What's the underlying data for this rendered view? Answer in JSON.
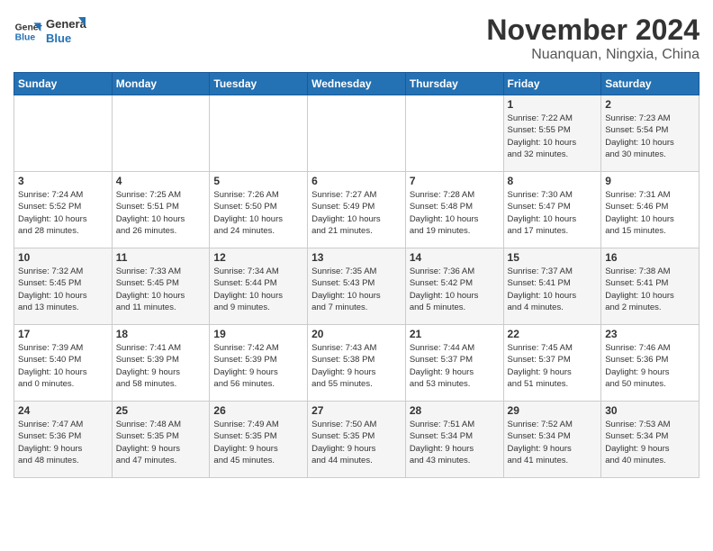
{
  "header": {
    "logo_line1": "General",
    "logo_line2": "Blue",
    "month": "November 2024",
    "location": "Nuanquan, Ningxia, China"
  },
  "days_of_week": [
    "Sunday",
    "Monday",
    "Tuesday",
    "Wednesday",
    "Thursday",
    "Friday",
    "Saturday"
  ],
  "weeks": [
    [
      {
        "day": null,
        "info": null
      },
      {
        "day": null,
        "info": null
      },
      {
        "day": null,
        "info": null
      },
      {
        "day": null,
        "info": null
      },
      {
        "day": null,
        "info": null
      },
      {
        "day": "1",
        "info": "Sunrise: 7:22 AM\nSunset: 5:55 PM\nDaylight: 10 hours\nand 32 minutes."
      },
      {
        "day": "2",
        "info": "Sunrise: 7:23 AM\nSunset: 5:54 PM\nDaylight: 10 hours\nand 30 minutes."
      }
    ],
    [
      {
        "day": "3",
        "info": "Sunrise: 7:24 AM\nSunset: 5:52 PM\nDaylight: 10 hours\nand 28 minutes."
      },
      {
        "day": "4",
        "info": "Sunrise: 7:25 AM\nSunset: 5:51 PM\nDaylight: 10 hours\nand 26 minutes."
      },
      {
        "day": "5",
        "info": "Sunrise: 7:26 AM\nSunset: 5:50 PM\nDaylight: 10 hours\nand 24 minutes."
      },
      {
        "day": "6",
        "info": "Sunrise: 7:27 AM\nSunset: 5:49 PM\nDaylight: 10 hours\nand 21 minutes."
      },
      {
        "day": "7",
        "info": "Sunrise: 7:28 AM\nSunset: 5:48 PM\nDaylight: 10 hours\nand 19 minutes."
      },
      {
        "day": "8",
        "info": "Sunrise: 7:30 AM\nSunset: 5:47 PM\nDaylight: 10 hours\nand 17 minutes."
      },
      {
        "day": "9",
        "info": "Sunrise: 7:31 AM\nSunset: 5:46 PM\nDaylight: 10 hours\nand 15 minutes."
      }
    ],
    [
      {
        "day": "10",
        "info": "Sunrise: 7:32 AM\nSunset: 5:45 PM\nDaylight: 10 hours\nand 13 minutes."
      },
      {
        "day": "11",
        "info": "Sunrise: 7:33 AM\nSunset: 5:45 PM\nDaylight: 10 hours\nand 11 minutes."
      },
      {
        "day": "12",
        "info": "Sunrise: 7:34 AM\nSunset: 5:44 PM\nDaylight: 10 hours\nand 9 minutes."
      },
      {
        "day": "13",
        "info": "Sunrise: 7:35 AM\nSunset: 5:43 PM\nDaylight: 10 hours\nand 7 minutes."
      },
      {
        "day": "14",
        "info": "Sunrise: 7:36 AM\nSunset: 5:42 PM\nDaylight: 10 hours\nand 5 minutes."
      },
      {
        "day": "15",
        "info": "Sunrise: 7:37 AM\nSunset: 5:41 PM\nDaylight: 10 hours\nand 4 minutes."
      },
      {
        "day": "16",
        "info": "Sunrise: 7:38 AM\nSunset: 5:41 PM\nDaylight: 10 hours\nand 2 minutes."
      }
    ],
    [
      {
        "day": "17",
        "info": "Sunrise: 7:39 AM\nSunset: 5:40 PM\nDaylight: 10 hours\nand 0 minutes."
      },
      {
        "day": "18",
        "info": "Sunrise: 7:41 AM\nSunset: 5:39 PM\nDaylight: 9 hours\nand 58 minutes."
      },
      {
        "day": "19",
        "info": "Sunrise: 7:42 AM\nSunset: 5:39 PM\nDaylight: 9 hours\nand 56 minutes."
      },
      {
        "day": "20",
        "info": "Sunrise: 7:43 AM\nSunset: 5:38 PM\nDaylight: 9 hours\nand 55 minutes."
      },
      {
        "day": "21",
        "info": "Sunrise: 7:44 AM\nSunset: 5:37 PM\nDaylight: 9 hours\nand 53 minutes."
      },
      {
        "day": "22",
        "info": "Sunrise: 7:45 AM\nSunset: 5:37 PM\nDaylight: 9 hours\nand 51 minutes."
      },
      {
        "day": "23",
        "info": "Sunrise: 7:46 AM\nSunset: 5:36 PM\nDaylight: 9 hours\nand 50 minutes."
      }
    ],
    [
      {
        "day": "24",
        "info": "Sunrise: 7:47 AM\nSunset: 5:36 PM\nDaylight: 9 hours\nand 48 minutes."
      },
      {
        "day": "25",
        "info": "Sunrise: 7:48 AM\nSunset: 5:35 PM\nDaylight: 9 hours\nand 47 minutes."
      },
      {
        "day": "26",
        "info": "Sunrise: 7:49 AM\nSunset: 5:35 PM\nDaylight: 9 hours\nand 45 minutes."
      },
      {
        "day": "27",
        "info": "Sunrise: 7:50 AM\nSunset: 5:35 PM\nDaylight: 9 hours\nand 44 minutes."
      },
      {
        "day": "28",
        "info": "Sunrise: 7:51 AM\nSunset: 5:34 PM\nDaylight: 9 hours\nand 43 minutes."
      },
      {
        "day": "29",
        "info": "Sunrise: 7:52 AM\nSunset: 5:34 PM\nDaylight: 9 hours\nand 41 minutes."
      },
      {
        "day": "30",
        "info": "Sunrise: 7:53 AM\nSunset: 5:34 PM\nDaylight: 9 hours\nand 40 minutes."
      }
    ]
  ]
}
